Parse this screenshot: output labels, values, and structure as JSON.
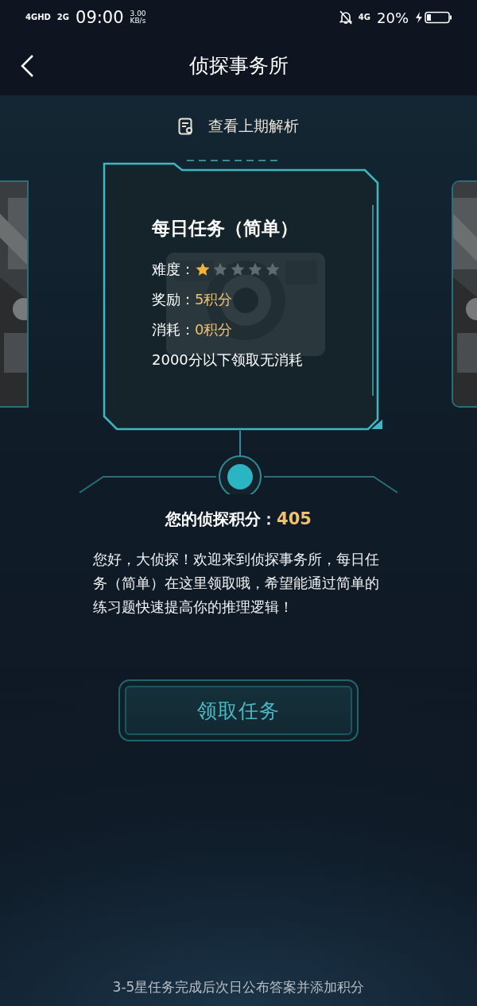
{
  "status_bar": {
    "network_1": "4GHD",
    "network_2": "2G",
    "time": "09:00",
    "speed": "3.00",
    "speed_unit": "KB/s",
    "data_network": "4G",
    "battery": "20%"
  },
  "header": {
    "title": "侦探事务所"
  },
  "history_link": {
    "label": "查看上期解析"
  },
  "task_card": {
    "title": "每日任务（简单）",
    "difficulty_label": "难度：",
    "stars": 1,
    "reward_label": "奖励：",
    "reward": "5积分",
    "cost_label": "消耗：",
    "cost": "0积分",
    "note": "2000分以下领取无消耗"
  },
  "score": {
    "label": "您的侦探积分：",
    "value": "405"
  },
  "intro": "您好，大侦探！欢迎来到侦探事务所，每日任务（简单）在这里领取哦，希望能通过简单的练习题快速提高你的推理逻辑！",
  "claim_button": {
    "label": "领取任务"
  },
  "footer_note": "3-5星任务完成后次日公布答案并添加积分"
}
